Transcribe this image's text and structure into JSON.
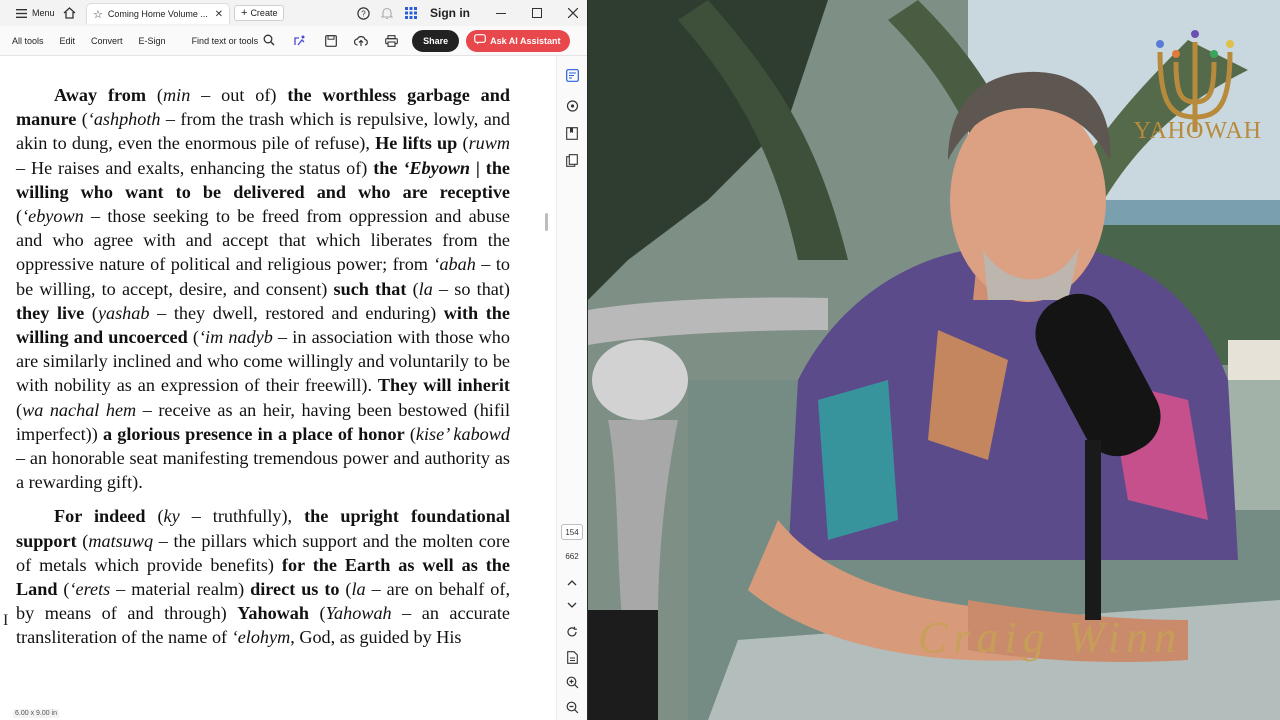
{
  "titlebar": {
    "menu_label": "Menu",
    "tab_title": "Coming Home Volume ...",
    "create_label": "Create",
    "signin_label": "Sign in"
  },
  "toolbar": {
    "all_tools": "All tools",
    "edit": "Edit",
    "convert": "Convert",
    "esign": "E-Sign",
    "find": "Find text or tools",
    "share": "Share",
    "ai_assistant": "Ask AI Assistant"
  },
  "pdf": {
    "paragraphs": [
      "<b>Away from</b> (<i>min</i> – out of) <b>the worthless garbage and manure</b> (<i>‘ashphoth</i> – from the trash which is repulsive, lowly, and akin to dung, even the enormous pile of refuse), <b>He lifts up</b> (<i>ruwm</i> – He raises and exalts, enhancing the status of) <b>the <i>‘Ebyown</i> | the willing who want to be delivered and who are receptive</b> (<i>‘ebyown</i> – those seeking to be freed from oppression and abuse and who agree with and accept that which liberates from the oppressive nature of political and religious power; from <i>‘abah</i> – to be willing, to accept, desire, and consent) <b>such that</b> (<i>la</i> – so that) <b>they live</b> (<i>yashab</i> – they dwell, restored and enduring) <b>with the willing and uncoerced</b> (<i>‘im nadyb</i> – in association with those who are similarly inclined and who come willingly and voluntarily to be with nobility as an expression of their freewill). <b>They will inherit</b> (<i>wa nachal hem</i> – receive as an heir, having been bestowed (hifil imperfect)) <b>a glorious presence in a place of honor</b> (<i>kise’ kabowd</i> – an honorable seat manifesting tremendous power and authority as a rewarding gift).",
      "<b>For indeed</b> (<i>ky</i> – truthfully), <b>the upright foundational support</b> (<i>matsuwq</i> – the pillars which support and the molten core of metals which provide benefits) <b>for the Earth as well as the Land</b> (<i>‘erets</i> – material realm) <b>direct us to</b> (<i>la</i> – are on behalf of, by means of and through) <b>Yahowah</b> (<i>Yahowah</i> – an accurate transliteration of the name of <i>‘elohym</i>, God, as guided by His"
    ],
    "page_size": "6.00 x 9.00 in"
  },
  "rail": {
    "current_page": "154",
    "total_pages": "662"
  },
  "video": {
    "logo_text": "YAHOWAH",
    "signature_text": "Craig Winn"
  },
  "colors": {
    "accent_ai": "#e8474c",
    "logo_gold": "#b78a3c"
  }
}
